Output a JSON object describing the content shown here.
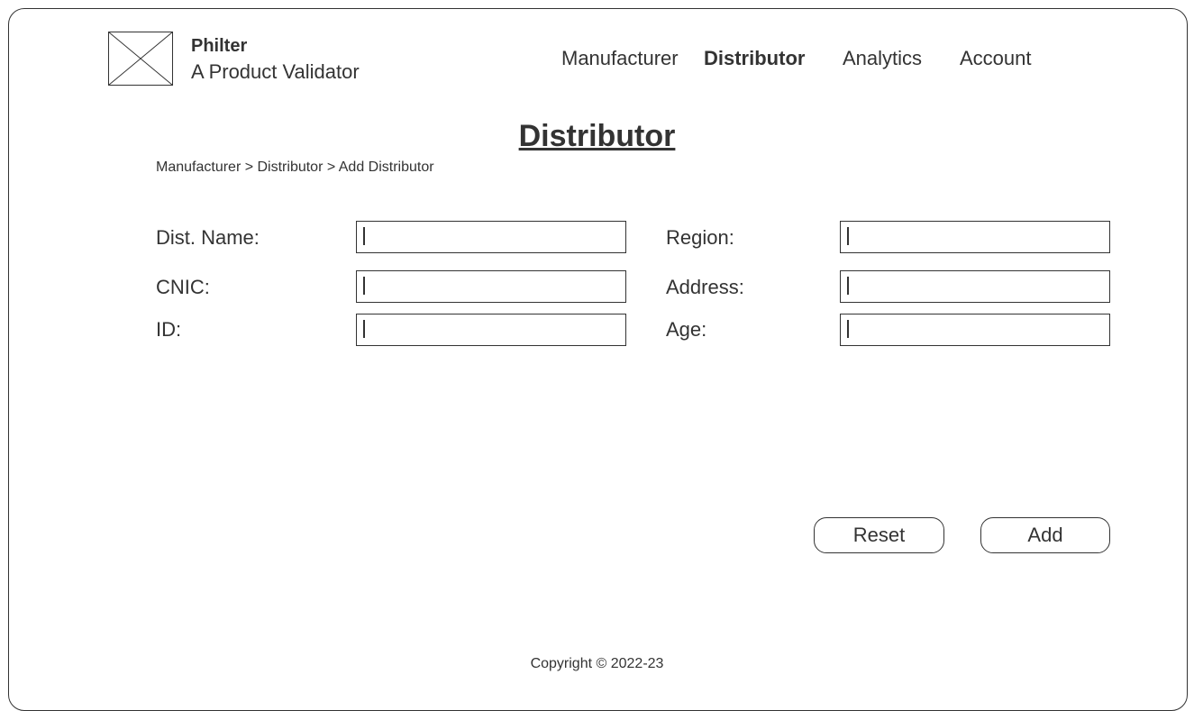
{
  "brand": {
    "name": "Philter",
    "tagline": "A Product Validator",
    "logo_icon": "image-placeholder-icon"
  },
  "nav": {
    "items": [
      {
        "label": "Manufacturer",
        "active": false
      },
      {
        "label": "Distributor",
        "active": true
      },
      {
        "label": "Analytics",
        "active": false
      },
      {
        "label": "Account",
        "active": false
      }
    ]
  },
  "page": {
    "title": "Distributor",
    "breadcrumb": "Manufacturer > Distributor > Add Distributor"
  },
  "form": {
    "dist_name": {
      "label": "Dist. Name:",
      "value": ""
    },
    "cnic": {
      "label": "CNIC:",
      "value": ""
    },
    "id": {
      "label": "ID:",
      "value": ""
    },
    "region": {
      "label": "Region:",
      "value": ""
    },
    "address": {
      "label": "Address:",
      "value": ""
    },
    "age": {
      "label": "Age:",
      "value": ""
    }
  },
  "actions": {
    "reset_label": "Reset",
    "add_label": "Add"
  },
  "footer": {
    "copyright": "Copyright © 2022-23"
  },
  "colors": {
    "ink": "#333333",
    "background": "#ffffff"
  }
}
